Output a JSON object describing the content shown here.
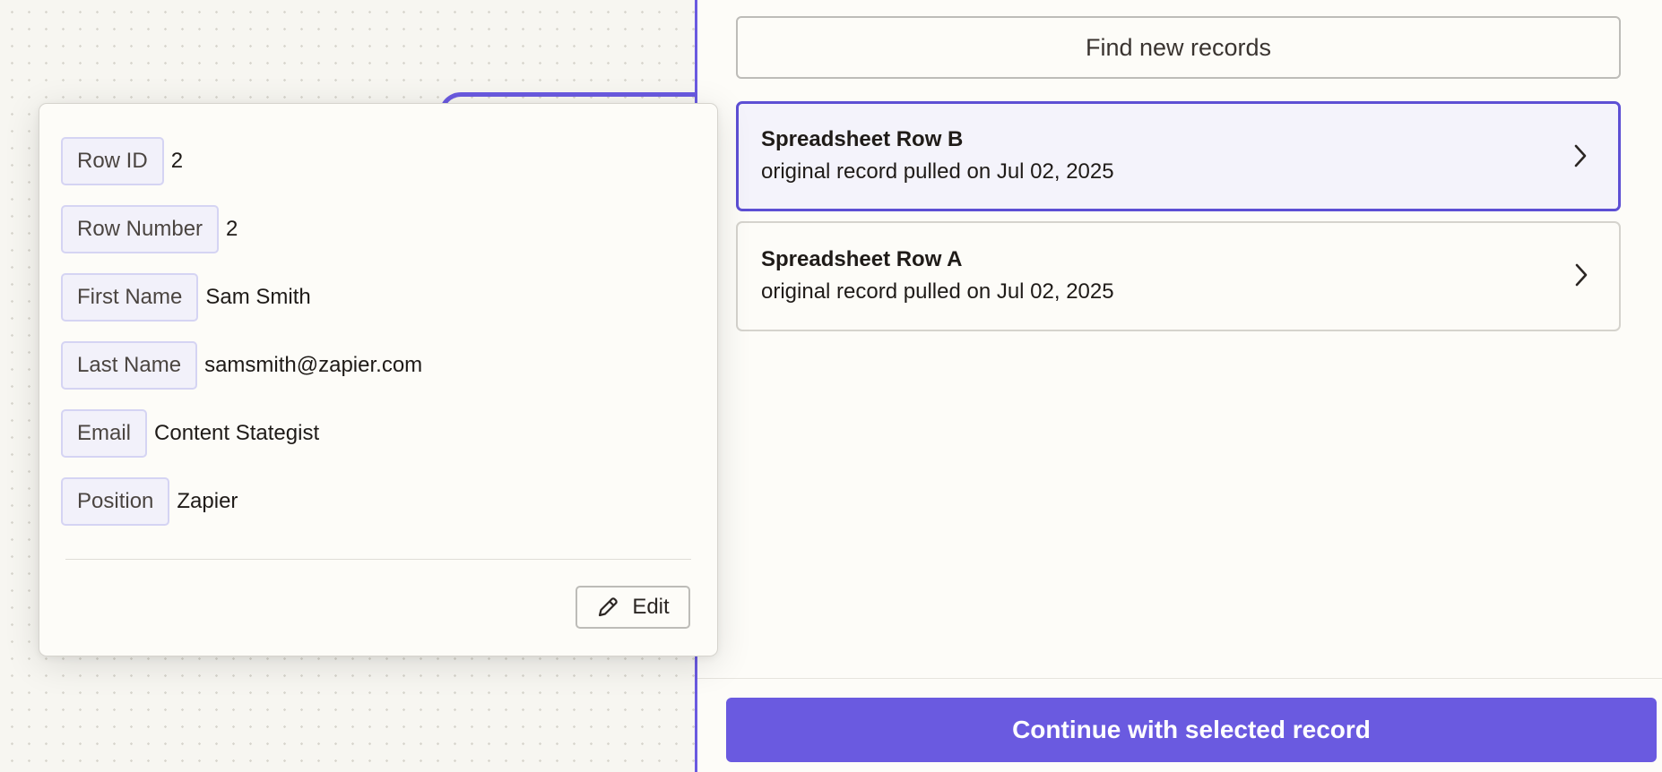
{
  "panel": {
    "find_button_label": "Find new records",
    "records": [
      {
        "title": "Spreadsheet Row B",
        "subtitle": "original record pulled on Jul 02, 2025",
        "selected": true
      },
      {
        "title": "Spreadsheet Row A",
        "subtitle": "original record pulled on Jul 02, 2025",
        "selected": false
      }
    ],
    "continue_button_label": "Continue with selected record"
  },
  "popover": {
    "fields": [
      {
        "label": "Row ID",
        "value": "2"
      },
      {
        "label": "Row Number",
        "value": "2"
      },
      {
        "label": "First Name",
        "value": "Sam Smith"
      },
      {
        "label": "Last Name",
        "value": "samsmith@zapier.com"
      },
      {
        "label": "Email",
        "value": "Content Stategist"
      },
      {
        "label": "Position",
        "value": "Zapier"
      }
    ],
    "edit_button_label": "Edit"
  },
  "icons": {
    "record_chevron": "chevron-right-icon",
    "edit": "pencil-icon"
  },
  "colors": {
    "accent": "#6a5ae0",
    "selected_border": "#5d4fd4",
    "selected_bg": "#f4f3fb",
    "label_bg": "#f2f1fa",
    "label_border": "#d5d4f3"
  }
}
